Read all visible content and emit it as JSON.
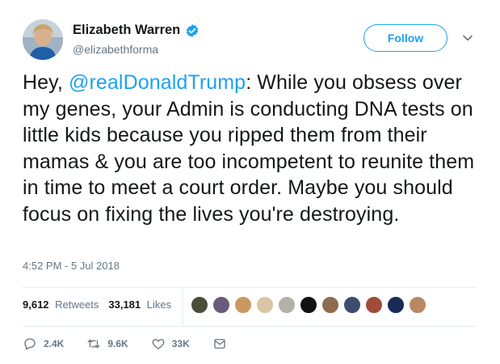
{
  "author": {
    "name": "Elizabeth Warren",
    "handle": "@elizabethforma",
    "verified": true
  },
  "header": {
    "follow_label": "Follow",
    "menu_icon": "chevron-down-icon"
  },
  "tweet": {
    "prefix": "Hey, ",
    "mention": "@realDonaldTrump",
    "body": ": While you obsess over my genes, your Admin is conducting DNA tests on little kids because you ripped them from their mamas & you are too incompetent to reunite them in time to meet a court order. Maybe you should focus on fixing the lives you're destroying.",
    "timestamp": "4:52 PM - 5 Jul 2018"
  },
  "stats": {
    "retweets_count": "9,612",
    "retweets_label": "Retweets",
    "likes_count": "33,181",
    "likes_label": "Likes"
  },
  "likers": [
    {
      "color": "#4a4f3c"
    },
    {
      "color": "#6b5b7a"
    },
    {
      "color": "#c9985f"
    },
    {
      "color": "#d9c6a5"
    },
    {
      "color": "#b3b0a8"
    },
    {
      "color": "#111111"
    },
    {
      "color": "#8f6b4d"
    },
    {
      "color": "#3b4e6e"
    },
    {
      "color": "#a14b3c"
    },
    {
      "color": "#1b2a55"
    },
    {
      "color": "#b98862"
    }
  ],
  "actions": {
    "reply_count": "2.4K",
    "retweet_count": "9.6K",
    "like_count": "33K"
  },
  "colors": {
    "accent": "#1da1f2",
    "text": "#14171a",
    "muted": "#657786",
    "divider": "#e6ecf0"
  }
}
